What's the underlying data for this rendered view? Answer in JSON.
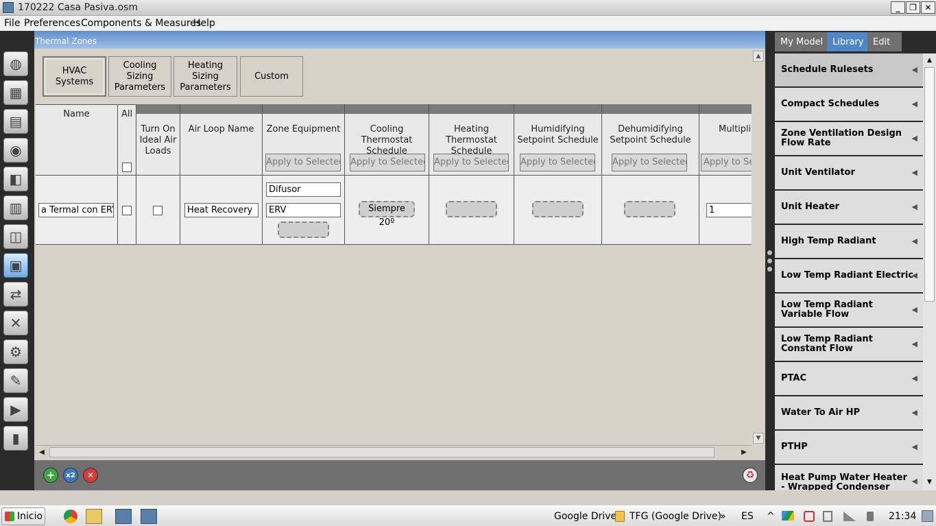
{
  "window": {
    "title": "170222 Casa Pasiva.osm",
    "controls": [
      "_",
      "❐",
      "✕"
    ]
  },
  "menu": [
    "File",
    "Preferences",
    "Components & Measures",
    "Help"
  ],
  "left_tools": [
    "globe-icon",
    "calendar-icon",
    "constructions-icon",
    "loads-icon",
    "space-types-icon",
    "building-icon",
    "geometry-icon",
    "thermal-zones-icon",
    "hvac-icon",
    "variables-icon",
    "settings-icon",
    "scripts-icon",
    "run-icon",
    "results-icon"
  ],
  "panel": {
    "title": "Thermal Zones",
    "tabs": [
      "HVAC\nSystems",
      "Cooling\nSizing\nParameters",
      "Heating\nSizing\nParameters",
      "Custom"
    ]
  },
  "grid": {
    "columns": {
      "name": "Name",
      "all": "All",
      "ideal": "Turn On Ideal Air Loads",
      "airloop": "Air Loop Name",
      "equipment": "Zone Equipment",
      "cooling": "Cooling Thermostat Schedule",
      "heating": "Heating Thermostat Schedule",
      "humidifying": "Humidifying Setpoint Schedule",
      "dehumidifying": "Dehumidifying Setpoint Schedule",
      "multiplier": "Multiplie"
    },
    "apply_label": "Apply to Selected",
    "apply_label_cut": "Apply to Sele",
    "row": {
      "name": "a Termal con ERV",
      "air_loop": "Heat Recovery",
      "equipment": [
        "Difusor",
        "ERV"
      ],
      "cooling_schedule": "Siempre 20º",
      "multiplier": "1"
    }
  },
  "bottom": {
    "add": "+",
    "copy": "x2",
    "remove": "✕",
    "purge": "♻"
  },
  "right_tabs": [
    "My Model",
    "Library",
    "Edit"
  ],
  "library": [
    "Schedule Rulesets",
    "Compact Schedules",
    "Zone Ventilation Design Flow Rate",
    "Unit Ventilator",
    "Unit Heater",
    "High Temp Radiant",
    "Low Temp Radiant Electric",
    "Low Temp Radiant Variable Flow",
    "Low Temp Radiant Constant Flow",
    "PTAC",
    "Water To Air HP",
    "PTHP",
    "Heat Pump Water Heater - Wrapped Condenser"
  ],
  "taskbar": {
    "start": "Inicio",
    "gdrive": "Google Drive",
    "tfg": "TFG (Google Drive)",
    "chevrons": "»",
    "lang": "ES",
    "tray_arrow": "^",
    "time": "21:34"
  }
}
